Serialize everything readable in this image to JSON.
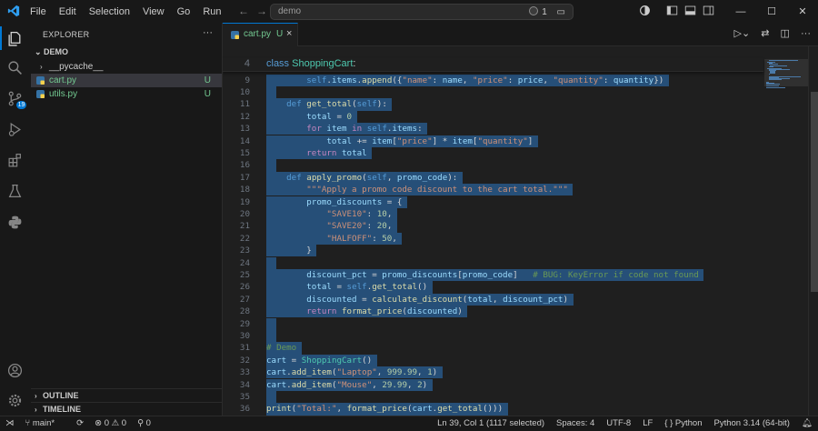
{
  "menu": [
    "File",
    "Edit",
    "Selection",
    "View",
    "Go",
    "Run"
  ],
  "nav": {
    "back": "←",
    "forward": "→"
  },
  "command_center": {
    "text": "demo",
    "agents_count": "1"
  },
  "window": {
    "minimize": "—",
    "maximize": "☐",
    "close": "✕"
  },
  "activity": {
    "scm_badge": "19"
  },
  "explorer": {
    "title": "EXPLORER",
    "folder": "DEMO",
    "items": [
      {
        "name": "__pycache__",
        "status": "",
        "type": "folder"
      },
      {
        "name": "cart.py",
        "status": "U",
        "type": "py"
      },
      {
        "name": "utils.py",
        "status": "U",
        "type": "py"
      }
    ],
    "outline": "OUTLINE",
    "timeline": "TIMELINE"
  },
  "tab": {
    "name": "cart.py",
    "status": "U",
    "close": "×"
  },
  "editor": {
    "sticky": {
      "num": "4",
      "text": "class ShoppingCart:"
    },
    "lines": [
      {
        "num": "9",
        "text": "        self.items.append({\"name\": name, \"price\": price, \"quantity\": quantity})"
      },
      {
        "num": "10",
        "text": ""
      },
      {
        "num": "11",
        "text": "    def get_total(self):"
      },
      {
        "num": "12",
        "text": "        total = 0"
      },
      {
        "num": "13",
        "text": "        for item in self.items:"
      },
      {
        "num": "14",
        "text": "            total += item[\"price\"] * item[\"quantity\"]"
      },
      {
        "num": "15",
        "text": "        return total"
      },
      {
        "num": "16",
        "text": ""
      },
      {
        "num": "17",
        "text": "    def apply_promo(self, promo_code):"
      },
      {
        "num": "18",
        "text": "        \"\"\"Apply a promo code discount to the cart total.\"\"\""
      },
      {
        "num": "19",
        "text": "        promo_discounts = {"
      },
      {
        "num": "20",
        "text": "            \"SAVE10\": 10,"
      },
      {
        "num": "21",
        "text": "            \"SAVE20\": 20,"
      },
      {
        "num": "22",
        "text": "            \"HALFOFF\": 50,"
      },
      {
        "num": "23",
        "text": "        }"
      },
      {
        "num": "24",
        "text": ""
      },
      {
        "num": "25",
        "text": "        discount_pct = promo_discounts[promo_code]   # BUG: KeyError if code not found"
      },
      {
        "num": "26",
        "text": "        total = self.get_total()"
      },
      {
        "num": "27",
        "text": "        discounted = calculate_discount(total, discount_pct)"
      },
      {
        "num": "28",
        "text": "        return format_price(discounted)"
      },
      {
        "num": "29",
        "text": ""
      },
      {
        "num": "30",
        "text": ""
      },
      {
        "num": "31",
        "text": "# Demo"
      },
      {
        "num": "32",
        "text": "cart = ShoppingCart()"
      },
      {
        "num": "33",
        "text": "cart.add_item(\"Laptop\", 999.99, 1)"
      },
      {
        "num": "34",
        "text": "cart.add_item(\"Mouse\", 29.99, 2)"
      },
      {
        "num": "35",
        "text": ""
      },
      {
        "num": "36",
        "text": "print(\"Total:\", format_price(cart.get_total()))"
      }
    ]
  },
  "status": {
    "branch": "main*",
    "problems": "⊗ 0 ⚠ 0",
    "ports": "⚲ 0",
    "position": "Ln 39, Col 1 (1117 selected)",
    "spaces": "Spaces: 4",
    "encoding": "UTF-8",
    "eol": "LF",
    "language": "{ } Python",
    "interpreter": "Python 3.14 (64-bit)"
  },
  "colors": {
    "accent": "#0078d4",
    "selection": "#264f78",
    "untracked": "#73c991"
  }
}
